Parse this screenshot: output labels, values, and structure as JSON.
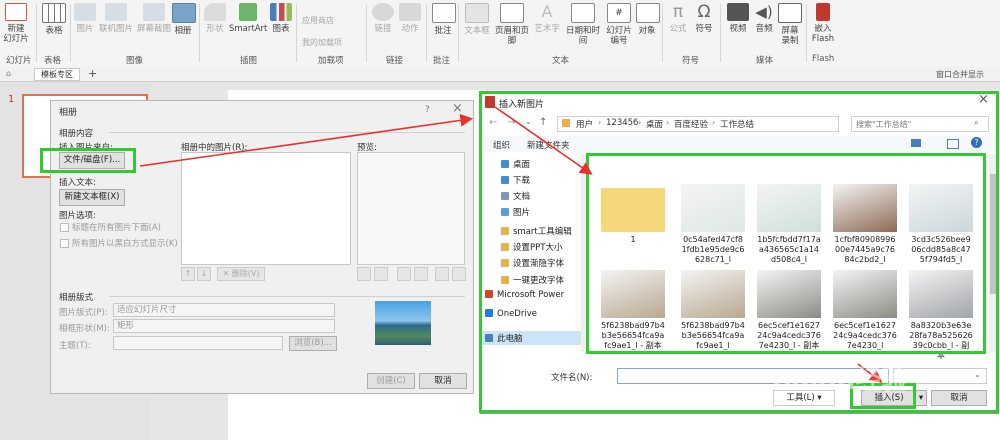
{
  "ribbon": {
    "buttons": [
      {
        "label": "新建\n幻灯片",
        "icon": "new-slide-icon"
      },
      {
        "label": "表格",
        "icon": "table-icon"
      },
      {
        "label": "图片",
        "icon": "picture-icon"
      },
      {
        "label": "联机图片",
        "icon": "online-picture-icon"
      },
      {
        "label": "屏幕截图",
        "icon": "screenshot-icon"
      },
      {
        "label": "相册",
        "icon": "photo-album-icon"
      },
      {
        "label": "形状",
        "icon": "shapes-icon"
      },
      {
        "label": "SmartArt",
        "icon": "smartart-icon"
      },
      {
        "label": "图表",
        "icon": "chart-icon"
      },
      {
        "label": "链接",
        "icon": "link-icon"
      },
      {
        "label": "动作",
        "icon": "action-icon"
      },
      {
        "label": "批注",
        "icon": "comment-icon"
      },
      {
        "label": "文本框",
        "icon": "textbox-icon"
      },
      {
        "label": "页眉和页脚",
        "icon": "header-footer-icon"
      },
      {
        "label": "艺术字",
        "icon": "wordart-icon"
      },
      {
        "label": "日期和时间",
        "icon": "date-time-icon"
      },
      {
        "label": "幻灯片\n编号",
        "icon": "slide-number-icon"
      },
      {
        "label": "对象",
        "icon": "object-icon"
      },
      {
        "label": "公式",
        "icon": "equation-icon"
      },
      {
        "label": "符号",
        "icon": "symbol-icon"
      },
      {
        "label": "视频",
        "icon": "video-icon"
      },
      {
        "label": "音频",
        "icon": "audio-icon"
      },
      {
        "label": "屏幕\n录制",
        "icon": "screen-record-icon"
      },
      {
        "label": "嵌入\nFlash",
        "icon": "flash-icon"
      }
    ],
    "addins": {
      "store": "应用商店",
      "my_addins": "我的加载项"
    },
    "groups": [
      "幻灯片",
      "表格",
      "图像",
      "插图",
      "加载项",
      "链接",
      "批注",
      "文本",
      "符号",
      "媒体",
      "Flash"
    ]
  },
  "tabbar": {
    "tab": "模板专区",
    "add": "+",
    "restore": "窗口合并显示"
  },
  "slide_panel": {
    "number": "1"
  },
  "album": {
    "title": "相册",
    "help": "?",
    "close": "×",
    "section_content": "相册内容",
    "insert_from": "插入图片来自:",
    "file_disk_button": "文件/磁盘(F)...",
    "insert_text": "插入文本:",
    "new_textbox_button": "新建文本框(X)",
    "picture_options": "图片选项:",
    "caption_below": "标题在所有图片下面(A)",
    "all_black_white": "所有图片以黑白方式显示(K)",
    "pictures_in_album": "相册中的图片(R):",
    "preview": "预览:",
    "delete_button": "删除(V)",
    "section_layout": "相册版式",
    "picture_layout_label": "图片版式(P):",
    "picture_layout_value": "适应幻灯片尺寸",
    "frame_shape_label": "相框形状(M):",
    "frame_shape_value": "矩形",
    "theme_label": "主题(T):",
    "browse_button": "浏览(B)...",
    "create_button": "创建(C)",
    "cancel_button": "取消"
  },
  "insert_picture": {
    "title": "插入新图片",
    "close": "×",
    "breadcrumb": [
      "用户",
      "123456",
      "桌面",
      "百度经验",
      "工作总结"
    ],
    "search_placeholder": "搜索\"工作总结\"",
    "organize": "组织",
    "new_folder": "新建文件夹",
    "nav": [
      {
        "label": "桌面",
        "color": "#3c8fd8"
      },
      {
        "label": "下载",
        "color": "#3c8fd8"
      },
      {
        "label": "文档",
        "color": "#7e9ab8"
      },
      {
        "label": "图片",
        "color": "#5aa0d8"
      },
      {
        "label": "smart工具编辑",
        "color": "#e6b34a"
      },
      {
        "label": "设置PPT大小",
        "color": "#e6b34a"
      },
      {
        "label": "设置渐隐字体",
        "color": "#e6b34a"
      },
      {
        "label": "一键更改字体",
        "color": "#e6b34a"
      },
      {
        "label": "Microsoft Power",
        "color": "#d24726"
      },
      {
        "label": "OneDrive",
        "color": "#1f7fd6"
      },
      {
        "label": "此电脑",
        "color": "#4a7fb5"
      }
    ],
    "files": [
      {
        "caption": "1",
        "color": "#f6d77a"
      },
      {
        "caption": "0c54afed47cf81fdb1e95de9c6628c71_l",
        "color": "#dfe8e4"
      },
      {
        "caption": "1b5fcfbdd7f17aa436565c1a14d508c4_l",
        "color": "#cfe0da"
      },
      {
        "caption": "1cfbf8090899600e7445a9c7684c2bd2_l",
        "color": "#8d6a55"
      },
      {
        "caption": "3cd3c526bee906cdd85a8c475f794fd5_l",
        "color": "#cbd7dc"
      },
      {
        "caption": "5f6238bad97b4b3e56654fca9afc9ae1_l - 副本",
        "color": "#b8a890"
      },
      {
        "caption": "5f6238bad97b4b3e56654fca9afc9ae1_l",
        "color": "#b8a890"
      },
      {
        "caption": "6ec5cef1e162724c9a4cedc3767e4230_l - 副本",
        "color": "#8c8c86"
      },
      {
        "caption": "6ec5cef1e162724c9a4cedc3767e4230_l",
        "color": "#8c8c86"
      },
      {
        "caption": "8a8320b3e63e28fa78a52562639c0cbb_l - 副本",
        "color": "#a0a4a8"
      }
    ],
    "filename_label": "文件名(N):",
    "filename_value": "",
    "tools_button": "工具(L)",
    "insert_button": "插入(S)",
    "cancel_button": "取消"
  },
  "watermark": {
    "text": "Baidu经验",
    "url": "jingyan.baidu.com"
  },
  "colors": {
    "highlight": "#33c933",
    "arrow": "#e8302e",
    "ppt_accent": "#c0392b"
  }
}
